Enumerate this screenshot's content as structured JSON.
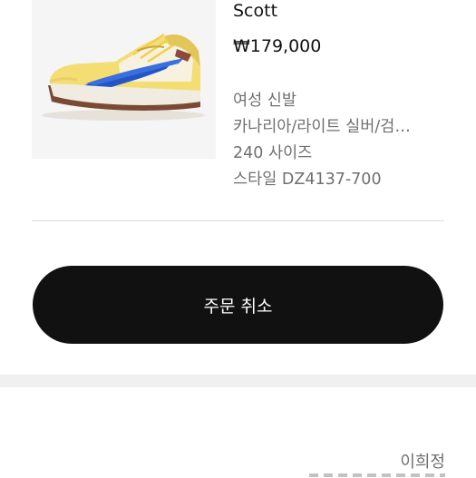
{
  "product": {
    "image_icon": "sneaker-product-photo",
    "name_tail": "Scott",
    "price": "₩179,000",
    "gender": "여성 신발",
    "color": "카나리아/라이트 실버/검…",
    "size": "240 사이즈",
    "style": "스타일 DZ4137-700"
  },
  "actions": {
    "cancel_order_label": "주문 취소"
  },
  "shipping": {
    "recipient_name": "이희정"
  },
  "colors": {
    "button_bg": "#111111",
    "button_text": "#ffffff",
    "secondary_text": "#707072",
    "image_bg": "#f5f5f5",
    "section_band": "#f0f0f0"
  }
}
